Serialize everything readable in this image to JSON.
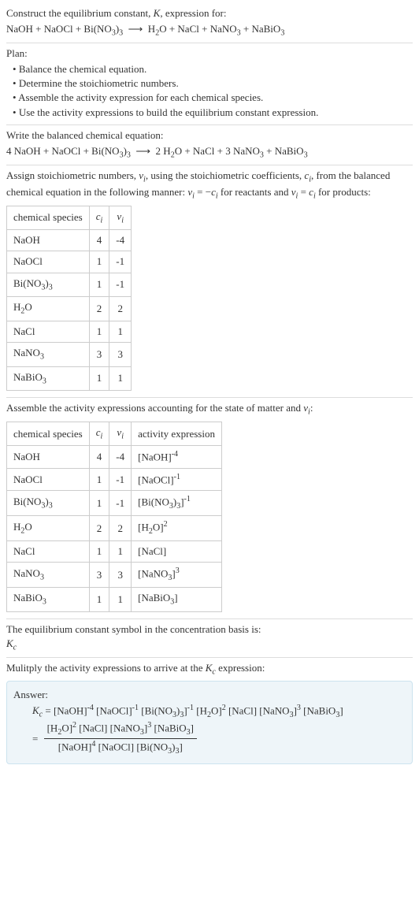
{
  "prompt": {
    "line1": "Construct the equilibrium constant, K, expression for:",
    "eqn": "NaOH + NaOCl + Bi(NO₃)₃ ⟶ H₂O + NaCl + NaNO₃ + NaBiO₃"
  },
  "plan": {
    "heading": "Plan:",
    "items": [
      "Balance the chemical equation.",
      "Determine the stoichiometric numbers.",
      "Assemble the activity expression for each chemical species.",
      "Use the activity expressions to build the equilibrium constant expression."
    ]
  },
  "balanced": {
    "heading": "Write the balanced chemical equation:",
    "eqn": "4 NaOH + NaOCl + Bi(NO₃)₃ ⟶ 2 H₂O + NaCl + 3 NaNO₃ + NaBiO₃"
  },
  "stoich_text": "Assign stoichiometric numbers, νᵢ, using the stoichiometric coefficients, cᵢ, from the balanced chemical equation in the following manner: νᵢ = −cᵢ for reactants and νᵢ = cᵢ for products:",
  "table1": {
    "headers": [
      "chemical species",
      "cᵢ",
      "νᵢ"
    ],
    "rows": [
      {
        "sp": "NaOH",
        "c": "4",
        "v": "-4"
      },
      {
        "sp": "NaOCl",
        "c": "1",
        "v": "-1"
      },
      {
        "sp": "Bi(NO₃)₃",
        "c": "1",
        "v": "-1"
      },
      {
        "sp": "H₂O",
        "c": "2",
        "v": "2"
      },
      {
        "sp": "NaCl",
        "c": "1",
        "v": "1"
      },
      {
        "sp": "NaNO₃",
        "c": "3",
        "v": "3"
      },
      {
        "sp": "NaBiO₃",
        "c": "1",
        "v": "1"
      }
    ]
  },
  "activity_heading": "Assemble the activity expressions accounting for the state of matter and νᵢ:",
  "table2": {
    "headers": [
      "chemical species",
      "cᵢ",
      "νᵢ",
      "activity expression"
    ],
    "rows": [
      {
        "sp": "NaOH",
        "c": "4",
        "v": "-4",
        "expr": "[NaOH]⁻⁴"
      },
      {
        "sp": "NaOCl",
        "c": "1",
        "v": "-1",
        "expr": "[NaOCl]⁻¹"
      },
      {
        "sp": "Bi(NO₃)₃",
        "c": "1",
        "v": "-1",
        "expr": "[Bi(NO₃)₃]⁻¹"
      },
      {
        "sp": "H₂O",
        "c": "2",
        "v": "2",
        "expr": "[H₂O]²"
      },
      {
        "sp": "NaCl",
        "c": "1",
        "v": "1",
        "expr": "[NaCl]"
      },
      {
        "sp": "NaNO₃",
        "c": "3",
        "v": "3",
        "expr": "[NaNO₃]³"
      },
      {
        "sp": "NaBiO₃",
        "c": "1",
        "v": "1",
        "expr": "[NaBiO₃]"
      }
    ]
  },
  "kc_symbol": {
    "text": "The equilibrium constant symbol in the concentration basis is:",
    "sym": "K꜀"
  },
  "multiply": "Mulitply the activity expressions to arrive at the K꜀ expression:",
  "answer": {
    "label": "Answer:",
    "line1": "K꜀ = [NaOH]⁻⁴ [NaOCl]⁻¹ [Bi(NO₃)₃]⁻¹ [H₂O]² [NaCl] [NaNO₃]³ [NaBiO₃]",
    "frac_num": "[H₂O]² [NaCl] [NaNO₃]³ [NaBiO₃]",
    "frac_den": "[NaOH]⁴ [NaOCl] [Bi(NO₃)₃]"
  }
}
